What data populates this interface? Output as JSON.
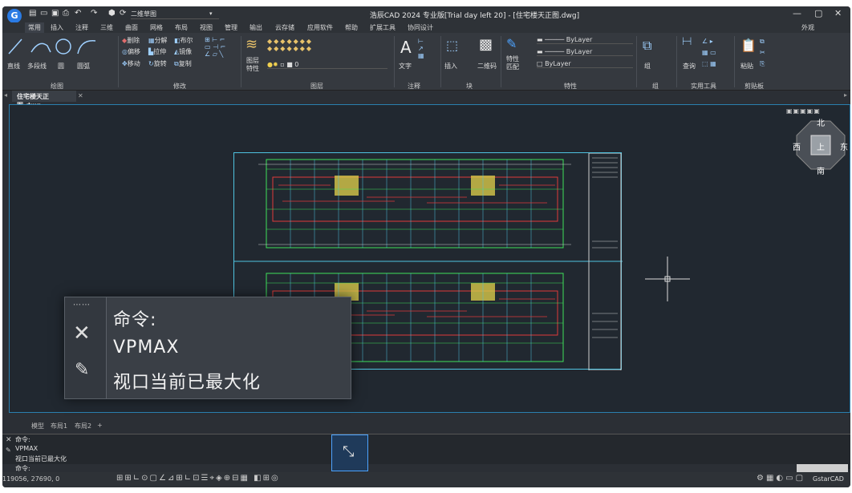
{
  "app": {
    "logo": "G",
    "title": "浩辰CAD 2024 专业版[Trial day left 20] - [住宅楼天正图.dwg]",
    "workspace": "二维草图",
    "appearance": "外观",
    "quick_icons": [
      "new-icon",
      "open-icon",
      "save-icon",
      "print-icon",
      "undo-icon",
      "redo-icon",
      "plugin-icon",
      "help-icon"
    ]
  },
  "menus": [
    "常用",
    "插入",
    "注释",
    "三维",
    "曲面",
    "网格",
    "布局",
    "视图",
    "管理",
    "输出",
    "云存储",
    "应用软件",
    "帮助",
    "扩展工具",
    "协同设计"
  ],
  "ribbon": {
    "draw": {
      "line": "直线",
      "polyline": "多段线",
      "circle": "圆",
      "arc": "圆弧",
      "group": "绘图"
    },
    "modify": {
      "items": [
        "删除",
        "分解",
        "布尔",
        "偏移",
        "拉伸",
        "镜像",
        "移动",
        "旋转",
        "复制"
      ],
      "group": "修改"
    },
    "layers": {
      "button": "图层特性",
      "layer_value": "0",
      "group": "图层"
    },
    "annotation": {
      "text": "文字",
      "group": "注释"
    },
    "block": {
      "insert": "插入",
      "qrcode": "二维码",
      "group": "块"
    },
    "properties": {
      "match": "特性匹配",
      "rows": [
        "ByLayer",
        "ByLayer",
        "ByLayer"
      ],
      "group": "特性"
    },
    "groups_panel": {
      "button": "组",
      "group": "组"
    },
    "utilities": {
      "query": "查询",
      "group": "实用工具"
    },
    "clipboard": {
      "paste": "粘贴",
      "group": "剪贴板"
    }
  },
  "document_tab": "住宅楼天正图.dwg",
  "viewcube": {
    "north": "北",
    "south": "南",
    "east": "东",
    "west": "西",
    "top": "上"
  },
  "layout_tabs": [
    "模型",
    "布局1",
    "布局2"
  ],
  "zoom_panel": {
    "lines": [
      "命令:",
      "VPMAX",
      "视口当前已最大化"
    ]
  },
  "command_history": [
    "命令:",
    "VPMAX",
    "视口当前已最大化"
  ],
  "command_prompt": "命令:",
  "status": {
    "coordinates": "119056, 27690, 0",
    "brand": "GstarCAD"
  },
  "colors": {
    "accent": "#2a7be4",
    "canvas": "#212830",
    "drawing_green": "#3ee05a",
    "drawing_red": "#e03a3a",
    "drawing_cyan": "#4fc3e0"
  }
}
